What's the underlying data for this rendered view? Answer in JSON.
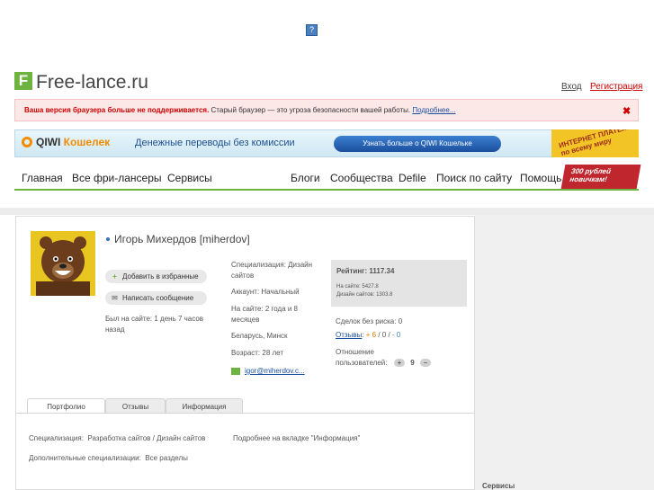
{
  "top_icon": "?",
  "logo": {
    "letter": "F",
    "text": "Free-lance.ru"
  },
  "auth": {
    "login": "Вход",
    "register": "Регистрация"
  },
  "warning": {
    "bold": "Ваша версия браузера больше не поддерживается.",
    "text": "Старый браузер — это угроза безопасности вашей работы.",
    "link": "Подробнее...",
    "close": "✖"
  },
  "qiwi": {
    "brand": "QIWI",
    "brand2": "Кошелек",
    "text": "Денежные переводы без комиссии",
    "button": "Узнать больше о QIWI Кошельке",
    "promo": "ИНТЕРНЕТ ПЛАТЕЖИ по всему миру"
  },
  "nav": {
    "left": [
      "Главная",
      "Все фри-лансеры",
      "Сервисы"
    ],
    "right": [
      "Блоги",
      "Сообщества",
      "Defile",
      "Поиск по сайту",
      "Помощь"
    ],
    "promo": "300 рублей новичкам!"
  },
  "profile": {
    "name": "Игорь Михердов [miherdov]",
    "add_fav": "Добавить в избранные",
    "send_msg": "Написать сообщение",
    "last_seen": "Был на сайте: 1 день 7 часов назад",
    "specialization": "Специализация: Дизайн сайтов",
    "account": "Аккаунт: Начальный",
    "on_site": "На сайте: 2 года и 8 месяцев",
    "location": "Беларусь, Минск",
    "age": "Возраст: 28 лет",
    "email": "igor@miherdov.c...",
    "rating_title": "Рейтинг: 1117.34",
    "rating_site": "На сайте: 5427.8",
    "rating_sites": "Дизайн сайтов: 1303.8",
    "safe_deals": "Сделок без риска: 0",
    "reviews_label": "Отзывы",
    "reviews_pos": "+ 6",
    "reviews_neu": "0",
    "reviews_neg": "- 0",
    "relation_label": "Отношение пользователей:",
    "relation_value": "9",
    "plus": "+",
    "minus": "−"
  },
  "tabs": [
    "Портфолио",
    "Отзывы",
    "Информация"
  ],
  "portfolio": {
    "spec_label": "Специализация:",
    "spec_value": "Разработка сайтов / Дизайн сайтов",
    "more_info": "Подробнее на вкладке \"Информация\"",
    "extra_label": "Дополнительные специализации:",
    "extra_value": "Все разделы"
  },
  "right_panel": {
    "services": "Сервисы"
  },
  "colors": {
    "accent": "#6db33f",
    "warning": "#cc0000",
    "link": "#1a4fa0"
  }
}
